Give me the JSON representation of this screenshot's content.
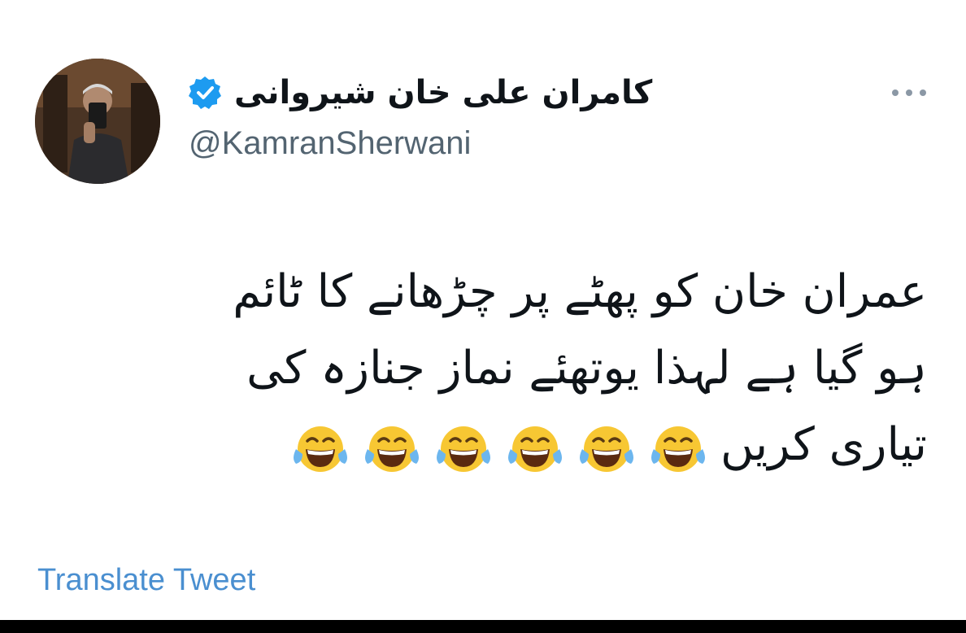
{
  "tweet": {
    "display_name": "کامران علی خان شیروانی",
    "handle": "@KamranSherwani",
    "verified_icon": "verified-badge-icon",
    "more_icon": "more-options-icon",
    "body_lines": [
      "عمران خان کو پھٹے پر چڑھانے کا ٹائم",
      "ہو گیا ہے لہذا یوتھئے نماز جنازہ کی",
      "تیاری کریں"
    ],
    "emoji_name": "face-with-tears-of-joy-icon",
    "emoji_count": 6,
    "translate_label": "Translate Tweet",
    "colors": {
      "accent": "#1d9bf0",
      "translate_link": "#4a8fd0",
      "text": "#0f1419",
      "muted": "#536471"
    }
  }
}
